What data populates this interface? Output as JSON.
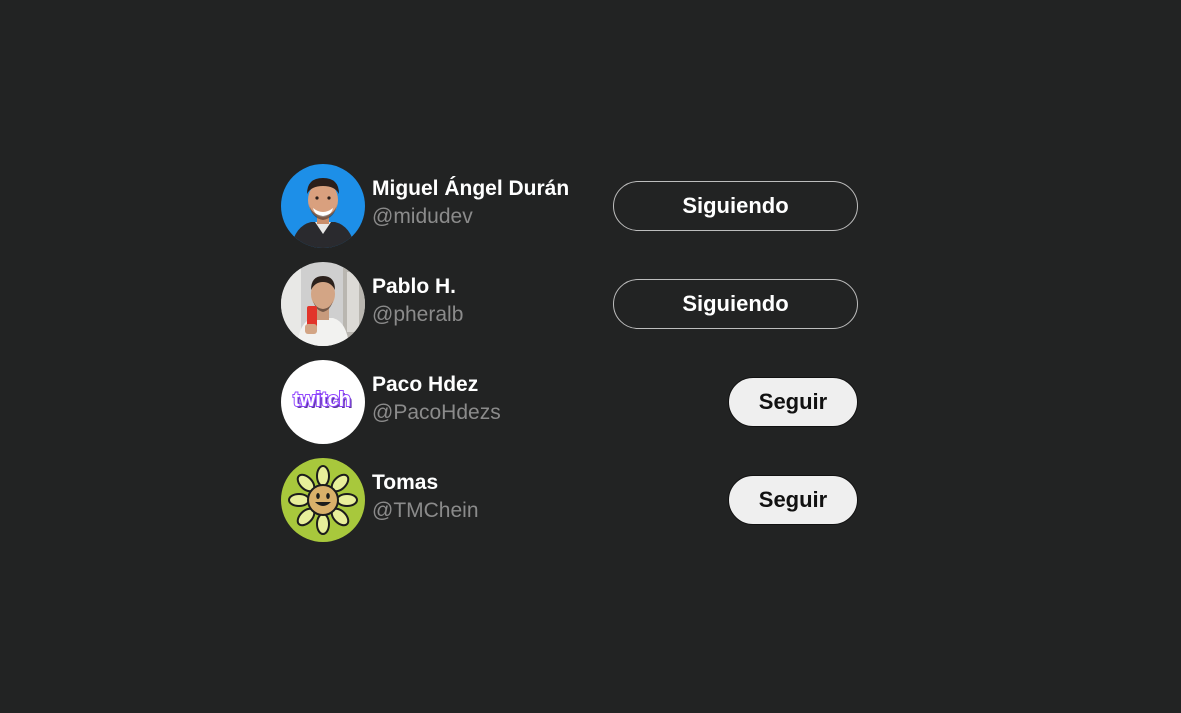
{
  "users": [
    {
      "name": "Miguel Ángel Durán",
      "handle": "@midudev",
      "button_label": "Siguiendo",
      "following": true,
      "avatar_icon": "person-photo",
      "avatar_bg": "#1d8fe8"
    },
    {
      "name": "Pablo H.",
      "handle": "@pheralb",
      "button_label": "Siguiendo",
      "following": true,
      "avatar_icon": "person-mirror-selfie",
      "avatar_bg": "#cfcfcf"
    },
    {
      "name": "Paco Hdez",
      "handle": "@PacoHdezs",
      "button_label": "Seguir",
      "following": false,
      "avatar_icon": "twitch-logo",
      "avatar_bg": "#ffffff",
      "avatar_text": "twitch"
    },
    {
      "name": "Tomas",
      "handle": "@TMChein",
      "button_label": "Seguir",
      "following": false,
      "avatar_icon": "smiling-flower",
      "avatar_bg": "#a8c83c"
    }
  ],
  "colors": {
    "background": "#222323",
    "name": "#ffffff",
    "handle": "#8b8b8b",
    "follow_button_bg": "#efefef",
    "following_button_border": "#bdbdbd"
  }
}
